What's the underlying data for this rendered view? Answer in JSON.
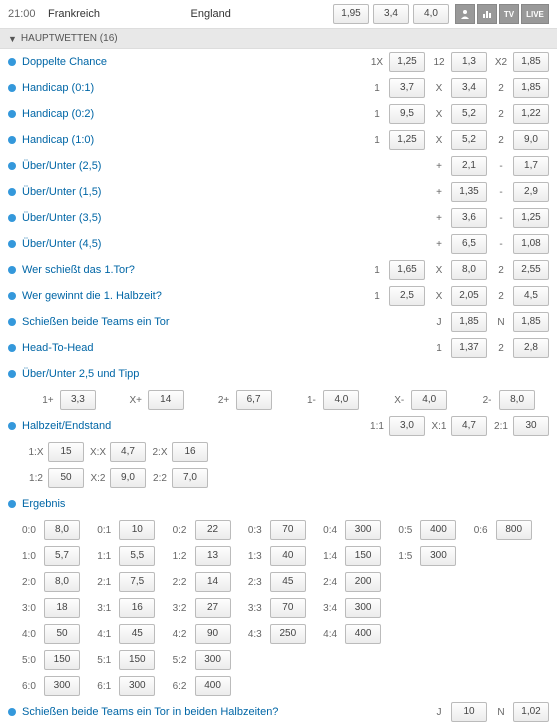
{
  "header": {
    "time": "21:00",
    "home": "Frankreich",
    "away": "England",
    "odds": [
      "1,95",
      "3,4",
      "4,0"
    ],
    "icons": [
      "people-icon",
      "stats-icon",
      "tv-icon",
      "live-icon"
    ],
    "icon_text": [
      "",
      "",
      "TV",
      "LIVE"
    ]
  },
  "section": {
    "title": "HAUPTWETTEN (16)"
  },
  "rows": [
    {
      "label": "Doppelte Chance",
      "bets": [
        [
          "1X",
          "1,25"
        ],
        [
          "12",
          "1,3"
        ],
        [
          "X2",
          "1,85"
        ]
      ]
    },
    {
      "label": "Handicap (0:1)",
      "bets": [
        [
          "1",
          "3,7"
        ],
        [
          "X",
          "3,4"
        ],
        [
          "2",
          "1,85"
        ]
      ]
    },
    {
      "label": "Handicap (0:2)",
      "bets": [
        [
          "1",
          "9,5"
        ],
        [
          "X",
          "5,2"
        ],
        [
          "2",
          "1,22"
        ]
      ]
    },
    {
      "label": "Handicap (1:0)",
      "bets": [
        [
          "1",
          "1,25"
        ],
        [
          "X",
          "5,2"
        ],
        [
          "2",
          "9,0"
        ]
      ]
    },
    {
      "label": "Über/Unter (2,5)",
      "bets": [
        [
          "+",
          "2,1"
        ],
        [
          "-",
          "1,7"
        ]
      ]
    },
    {
      "label": "Über/Unter (1,5)",
      "bets": [
        [
          "+",
          "1,35"
        ],
        [
          "-",
          "2,9"
        ]
      ]
    },
    {
      "label": "Über/Unter (3,5)",
      "bets": [
        [
          "+",
          "3,6"
        ],
        [
          "-",
          "1,25"
        ]
      ]
    },
    {
      "label": "Über/Unter (4,5)",
      "bets": [
        [
          "+",
          "6,5"
        ],
        [
          "-",
          "1,08"
        ]
      ]
    },
    {
      "label": "Wer schießt das 1.Tor?",
      "bets": [
        [
          "1",
          "1,65"
        ],
        [
          "X",
          "8,0"
        ],
        [
          "2",
          "2,55"
        ]
      ]
    },
    {
      "label": "Wer gewinnt die 1. Halbzeit?",
      "bets": [
        [
          "1",
          "2,5"
        ],
        [
          "X",
          "2,05"
        ],
        [
          "2",
          "4,5"
        ]
      ]
    },
    {
      "label": "Schießen beide Teams ein Tor",
      "bets": [
        [
          "J",
          "1,85"
        ],
        [
          "N",
          "1,85"
        ]
      ]
    },
    {
      "label": "Head-To-Head",
      "bets": [
        [
          "1",
          "1,37"
        ],
        [
          "2",
          "2,8"
        ]
      ]
    }
  ],
  "ou_tipp": {
    "label": "Über/Unter 2,5 und Tipp",
    "bets": [
      [
        "1+",
        "3,3"
      ],
      [
        "X+",
        "14"
      ],
      [
        "2+",
        "6,7"
      ],
      [
        "1-",
        "4,0"
      ],
      [
        "X-",
        "4,0"
      ],
      [
        "2-",
        "8,0"
      ]
    ]
  },
  "hz": {
    "label": "Halbzeit/Endstand",
    "rows": [
      [
        [
          "1:1",
          "3,0"
        ],
        [
          "X:1",
          "4,7"
        ],
        [
          "2:1",
          "30"
        ]
      ],
      [
        [
          "1:X",
          "15"
        ],
        [
          "X:X",
          "4,7"
        ],
        [
          "2:X",
          "16"
        ]
      ],
      [
        [
          "1:2",
          "50"
        ],
        [
          "X:2",
          "9,0"
        ],
        [
          "2:2",
          "7,0"
        ]
      ]
    ]
  },
  "erg": {
    "label": "Ergebnis",
    "rows": [
      [
        [
          "0:0",
          "8,0"
        ],
        [
          "0:1",
          "10"
        ],
        [
          "0:2",
          "22"
        ],
        [
          "0:3",
          "70"
        ],
        [
          "0:4",
          "300"
        ],
        [
          "0:5",
          "400"
        ],
        [
          "0:6",
          "800"
        ]
      ],
      [
        [
          "1:0",
          "5,7"
        ],
        [
          "1:1",
          "5,5"
        ],
        [
          "1:2",
          "13"
        ],
        [
          "1:3",
          "40"
        ],
        [
          "1:4",
          "150"
        ],
        [
          "1:5",
          "300"
        ]
      ],
      [
        [
          "2:0",
          "8,0"
        ],
        [
          "2:1",
          "7,5"
        ],
        [
          "2:2",
          "14"
        ],
        [
          "2:3",
          "45"
        ],
        [
          "2:4",
          "200"
        ]
      ],
      [
        [
          "3:0",
          "18"
        ],
        [
          "3:1",
          "16"
        ],
        [
          "3:2",
          "27"
        ],
        [
          "3:3",
          "70"
        ],
        [
          "3:4",
          "300"
        ]
      ],
      [
        [
          "4:0",
          "50"
        ],
        [
          "4:1",
          "45"
        ],
        [
          "4:2",
          "90"
        ],
        [
          "4:3",
          "250"
        ],
        [
          "4:4",
          "400"
        ]
      ],
      [
        [
          "5:0",
          "150"
        ],
        [
          "5:1",
          "150"
        ],
        [
          "5:2",
          "300"
        ]
      ],
      [
        [
          "6:0",
          "300"
        ],
        [
          "6:1",
          "300"
        ],
        [
          "6:2",
          "400"
        ]
      ]
    ]
  },
  "last": {
    "label": "Schießen beide Teams ein Tor in beiden Halbzeiten?",
    "bets": [
      [
        "J",
        "10"
      ],
      [
        "N",
        "1,02"
      ]
    ]
  }
}
